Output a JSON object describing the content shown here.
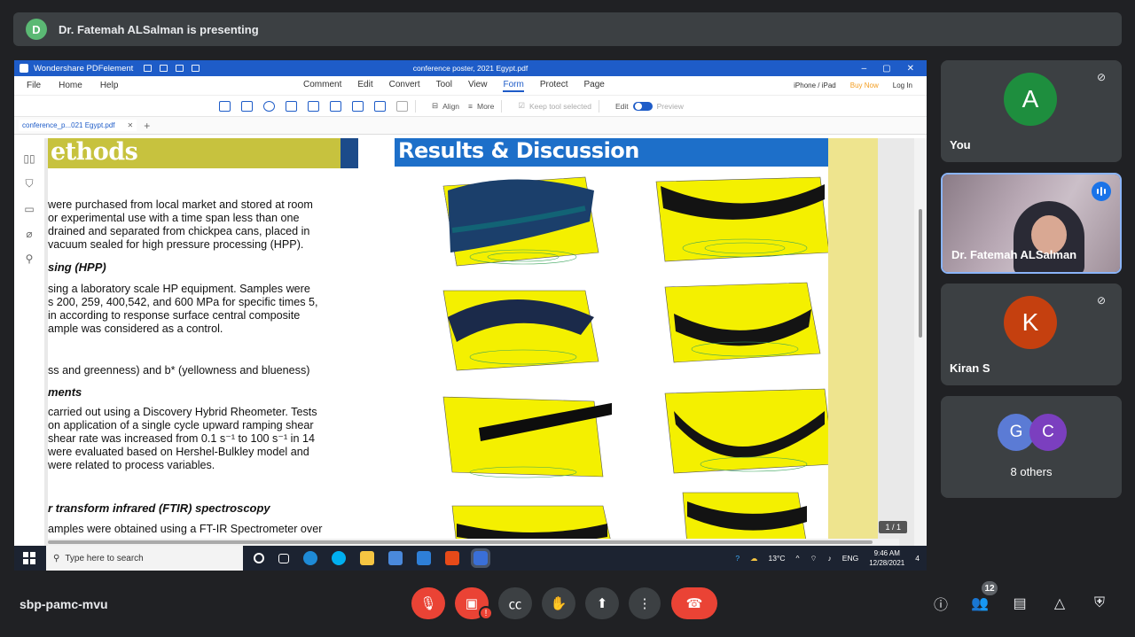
{
  "banner": {
    "initial": "D",
    "text": "Dr. Fatemah ALSalman is presenting"
  },
  "pdf": {
    "app_name": "Wondershare PDFelement",
    "doc_title": "conference poster, 2021 Egypt.pdf",
    "menu_left": [
      "File",
      "Home",
      "Help"
    ],
    "menu_center": [
      "Comment",
      "Edit",
      "Convert",
      "Tool",
      "View",
      "Form",
      "Protect",
      "Page"
    ],
    "menu_active": "Form",
    "menu_right": {
      "iphone": "iPhone / iPad",
      "buy": "Buy Now",
      "login": "Log In"
    },
    "toolbar": {
      "align": "Align",
      "more": "More",
      "keep": "Keep tool selected",
      "edit": "Edit",
      "preview": "Preview"
    },
    "tab": "conference_p...021 Egypt.pdf",
    "page_indicator": "1 / 1"
  },
  "poster": {
    "methods_title": "ethods",
    "results_title": "Results & Discussion",
    "p1": [
      "were purchased from local market and stored at room",
      "or experimental use with a time span less than one",
      "drained and separated from chickpea cans, placed in",
      "vacuum sealed for high pressure processing (HPP)."
    ],
    "h1": "sing (HPP)",
    "p2": [
      "sing a laboratory scale HP equipment. Samples were",
      "s 200, 259, 400,542, and 600 MPa for specific times 5,",
      "in according to response surface central composite",
      "ample was considered as a control."
    ],
    "p3": "ss and greenness) and b* (yellowness and blueness)",
    "h2": "ments",
    "p4": [
      "carried out using a Discovery Hybrid Rheometer. Tests",
      "on application of a single cycle upward ramping shear",
      "shear rate was increased from 0.1 s⁻¹ to 100 s⁻¹ in 14",
      "were evaluated based on Hershel-Bulkley model and",
      "were related to process variables."
    ],
    "h3": "r transform infrared (FTIR) spectroscopy",
    "p5": "amples were obtained using a FT-IR Spectrometer over"
  },
  "taskbar": {
    "search": "Type here to search",
    "weather": "13°C",
    "lang": "ENG",
    "time": "9:46 AM",
    "date": "12/28/2021",
    "notif": "4"
  },
  "participants": [
    {
      "initial": "A",
      "name": "You",
      "color": "#1e8e3e"
    },
    {
      "name": "Dr. Fatemah ALSalman"
    },
    {
      "initial": "K",
      "name": "Kiran S",
      "color": "#c5400f"
    },
    {
      "initials": [
        "G",
        "C"
      ],
      "name": "8 others",
      "colors": [
        "#5b7bd5",
        "#7b3fbf"
      ]
    }
  ],
  "meeting_code": "sbp-pamc-mvu",
  "people_count": "12"
}
